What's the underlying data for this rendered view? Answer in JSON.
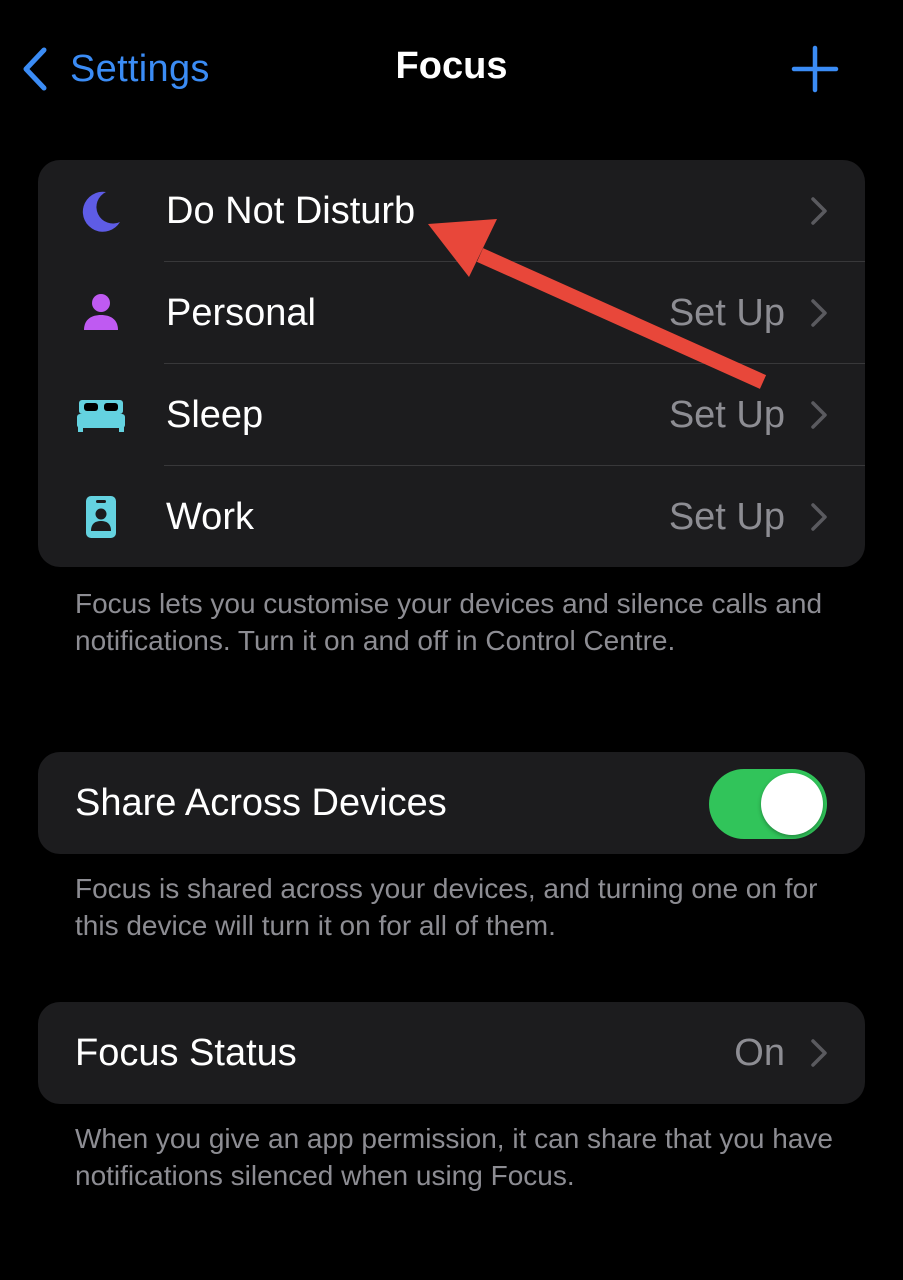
{
  "navbar": {
    "back_label": "Settings",
    "title": "Focus",
    "back_icon": "chevron-left-icon",
    "add_icon": "plus-icon",
    "accent_color": "#3b8cf5"
  },
  "focus_modes": [
    {
      "label": "Do Not Disturb",
      "value": "",
      "icon": "moon-icon",
      "color": "#5e5ce6"
    },
    {
      "label": "Personal",
      "value": "Set Up",
      "icon": "person-icon",
      "color": "#bf5af2"
    },
    {
      "label": "Sleep",
      "value": "Set Up",
      "icon": "bed-icon",
      "color": "#64d2e0"
    },
    {
      "label": "Work",
      "value": "Set Up",
      "icon": "id-badge-icon",
      "color": "#64d2e0"
    }
  ],
  "focus_footnote": "Focus lets you customise your devices and silence calls and notifications. Turn it on and off in Control Centre.",
  "share": {
    "label": "Share Across Devices",
    "enabled": true,
    "toggle_color": "#31c45a",
    "footnote": "Focus is shared across your devices, and turning one on for this device will turn it on for all of them."
  },
  "status": {
    "label": "Focus Status",
    "value": "On",
    "footnote": "When you give an app permission, it can share that you have notifications silenced when using Focus."
  },
  "annotation": {
    "color": "#e8473a"
  }
}
